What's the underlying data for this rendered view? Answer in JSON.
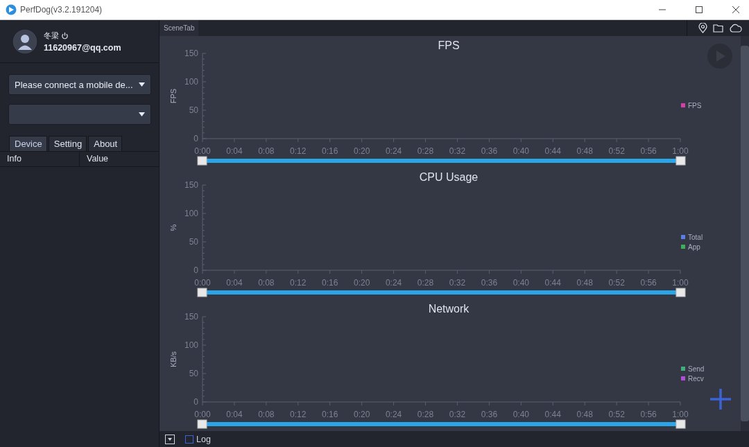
{
  "window": {
    "title": "PerfDog(v3.2.191204)"
  },
  "user": {
    "name": "冬梁",
    "email": "11620967@qq.com"
  },
  "selects": [
    {
      "kind": "device",
      "value": "Please connect a mobile de..."
    },
    {
      "kind": "app"
    }
  ],
  "tabs": [
    {
      "label": "Device",
      "selected": true
    },
    {
      "label": "Setting",
      "selected": false
    },
    {
      "label": "About",
      "selected": false
    }
  ],
  "info_table": {
    "columns": [
      "Info",
      "Value"
    ]
  },
  "scene_tab": {
    "label": "SceneTab"
  },
  "charts": [
    {
      "chart_data": {
        "type": "line",
        "title": "FPS",
        "ylabel": "FPS",
        "ylim": [
          0,
          150
        ],
        "yticks": [
          0,
          50,
          100,
          150
        ],
        "categories": [
          "0:00",
          "0:04",
          "0:08",
          "0:12",
          "0:16",
          "0:20",
          "0:24",
          "0:28",
          "0:32",
          "0:36",
          "0:40",
          "0:44",
          "0:48",
          "0:52",
          "0:56",
          "1:00"
        ],
        "series": [
          {
            "name": "FPS",
            "color": "#d63fa8",
            "values": [
              null,
              null,
              null,
              null,
              null,
              null,
              null,
              null,
              null,
              null,
              null,
              null,
              null,
              null,
              null,
              null
            ]
          }
        ]
      }
    },
    {
      "chart_data": {
        "type": "line",
        "title": "CPU Usage",
        "ylabel": "%",
        "ylim": [
          0,
          150
        ],
        "yticks": [
          0,
          50,
          100,
          150
        ],
        "categories": [
          "0:00",
          "0:04",
          "0:08",
          "0:12",
          "0:16",
          "0:20",
          "0:24",
          "0:28",
          "0:32",
          "0:36",
          "0:40",
          "0:44",
          "0:48",
          "0:52",
          "0:56",
          "1:00"
        ],
        "series": [
          {
            "name": "Total",
            "color": "#5b7de8",
            "values": [
              null,
              null,
              null,
              null,
              null,
              null,
              null,
              null,
              null,
              null,
              null,
              null,
              null,
              null,
              null,
              null
            ]
          },
          {
            "name": "App",
            "color": "#3fae5a",
            "values": [
              null,
              null,
              null,
              null,
              null,
              null,
              null,
              null,
              null,
              null,
              null,
              null,
              null,
              null,
              null,
              null
            ]
          }
        ]
      }
    },
    {
      "chart_data": {
        "type": "line",
        "title": "Network",
        "ylabel": "KB/s",
        "ylim": [
          0,
          150
        ],
        "yticks": [
          0,
          50,
          100,
          150
        ],
        "categories": [
          "0:00",
          "0:04",
          "0:08",
          "0:12",
          "0:16",
          "0:20",
          "0:24",
          "0:28",
          "0:32",
          "0:36",
          "0:40",
          "0:44",
          "0:48",
          "0:52",
          "0:56",
          "1:00"
        ],
        "series": [
          {
            "name": "Send",
            "color": "#3fae7a",
            "values": [
              null,
              null,
              null,
              null,
              null,
              null,
              null,
              null,
              null,
              null,
              null,
              null,
              null,
              null,
              null,
              null
            ]
          },
          {
            "name": "Recv",
            "color": "#b04ed8",
            "values": [
              null,
              null,
              null,
              null,
              null,
              null,
              null,
              null,
              null,
              null,
              null,
              null,
              null,
              null,
              null,
              null
            ]
          }
        ]
      }
    }
  ],
  "log": {
    "label": "Log",
    "checked": false
  }
}
